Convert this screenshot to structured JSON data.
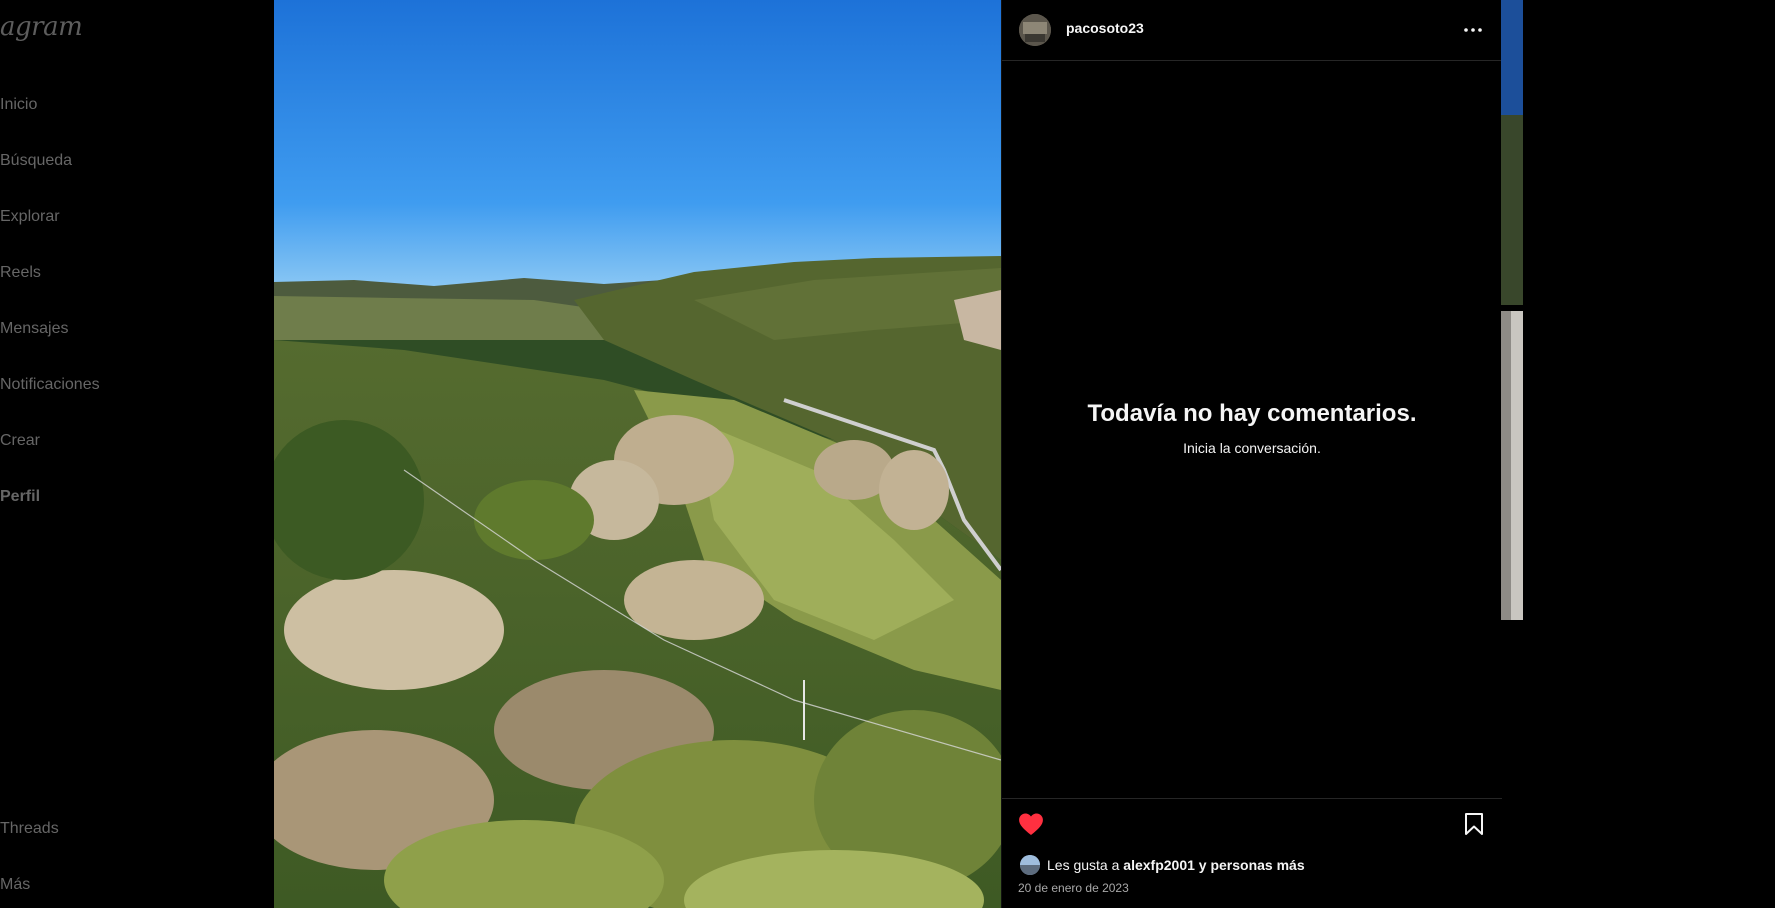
{
  "sidebar": {
    "logo": "agram",
    "items": [
      {
        "label": "Inicio"
      },
      {
        "label": "Búsqueda"
      },
      {
        "label": "Explorar"
      },
      {
        "label": "Reels"
      },
      {
        "label": "Mensajes"
      },
      {
        "label": "Notificaciones"
      },
      {
        "label": "Crear"
      },
      {
        "label": "Perfil"
      }
    ],
    "bottom_items": [
      {
        "label": "Threads"
      },
      {
        "label": "Más"
      }
    ]
  },
  "post": {
    "username": "pacosoto23",
    "more_icon": "more-horizontal-icon",
    "comments_empty_title": "Todavía no hay comentarios.",
    "comments_empty_subtitle": "Inicia la conversación.",
    "liked": true,
    "likes_prefix": "Les gusta a ",
    "likes_user": "alexfp2001",
    "likes_suffix": " y personas más",
    "date": "20 de enero de 2023"
  },
  "colors": {
    "background": "#000000",
    "like": "#ff3040",
    "text_primary": "#f5f5f5",
    "text_secondary": "#a8a8a8",
    "divider": "#262626"
  }
}
